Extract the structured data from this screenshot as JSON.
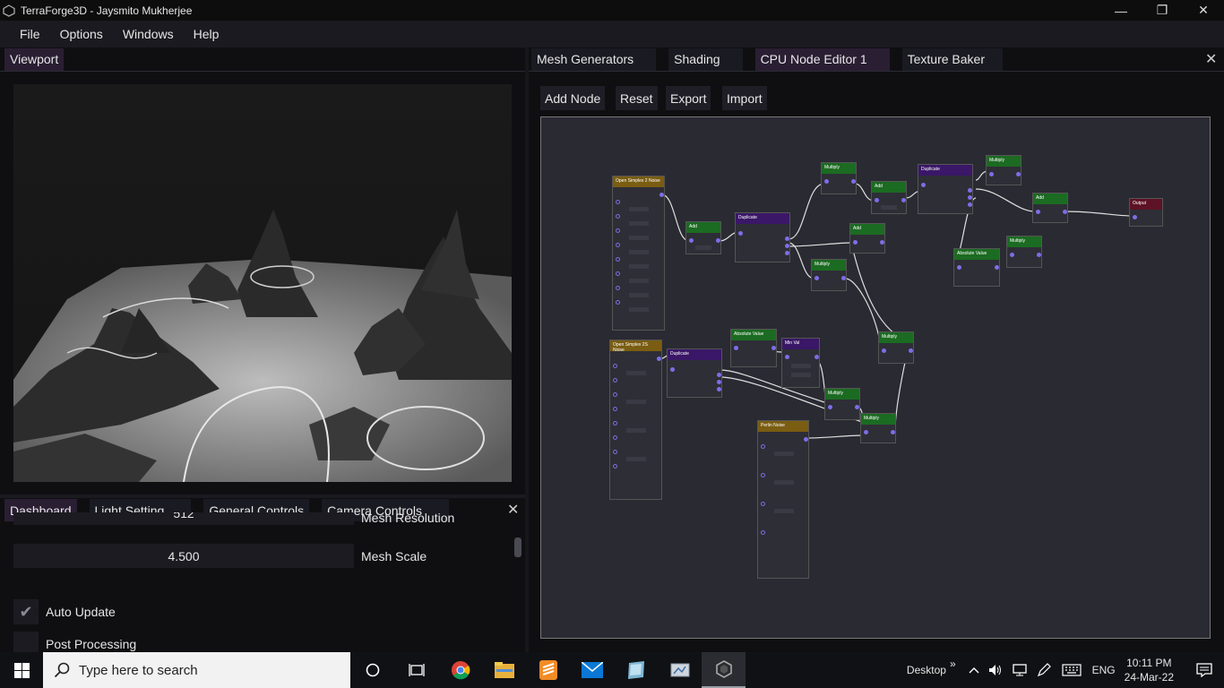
{
  "window": {
    "title": "TerraForge3D - Jaysmito Mukherjee",
    "minimize_glyph": "—",
    "maximize_glyph": "❐",
    "close_glyph": "✕"
  },
  "menu": [
    "File",
    "Options",
    "Windows",
    "Help"
  ],
  "viewport": {
    "tab": "Viewport"
  },
  "bottom_panel": {
    "tabs": [
      "Dashboard",
      "Light Setting",
      "General Controls",
      "Camera Controls"
    ],
    "close_glyph": "✕",
    "mesh_resolution": {
      "value": "512",
      "label": "Mesh Resolution"
    },
    "mesh_scale": {
      "value": "4.500",
      "label": "Mesh Scale"
    },
    "auto_update": {
      "label": "Auto Update",
      "checked": true
    },
    "post_processing": {
      "label": "Post Processing",
      "checked": false
    }
  },
  "editor": {
    "tabs": [
      "Mesh Generators",
      "Shading",
      "CPU Node Editor 1",
      "Texture Baker"
    ],
    "active_tab": "CPU Node Editor 1",
    "close_glyph": "✕",
    "toolbar": [
      "Add Node",
      "Reset",
      "Export",
      "Import"
    ]
  },
  "nodes": {
    "open_simplex_1": "Open Simplex 2 Noise",
    "open_simplex_2": "Open Simplex 2S Noise",
    "perlin_noise": "Perlin Noise",
    "add_1": "Add",
    "add_2": "Add",
    "add_3": "Add",
    "add_4": "Add",
    "duplicate_1": "Duplicate",
    "duplicate_2": "Duplicate",
    "duplicate_3": "Duplicate",
    "multiply_1": "Multiply",
    "multiply_2": "Multiply",
    "multiply_3": "Multiply",
    "multiply_4": "Multiply",
    "multiply_5": "Multiply",
    "multiply_6": "Multiply",
    "multiply_7": "Multiply",
    "absolute_1": "Absolute Value",
    "absolute_2": "Absolute Value",
    "min_val": "Min Val",
    "output": "Output"
  },
  "taskbar": {
    "search_placeholder": "Type here to search",
    "desktop_label": "Desktop",
    "chevron": "»",
    "language": "ENG",
    "time": "10:11 PM",
    "date": "24-Mar-22"
  }
}
